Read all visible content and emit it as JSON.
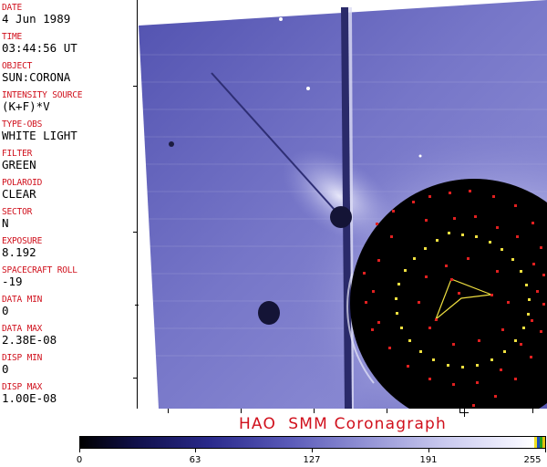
{
  "metadata": [
    {
      "label": "DATE",
      "value": "4 Jun 1989"
    },
    {
      "label": "TIME",
      "value": "03:44:56 UT"
    },
    {
      "label": "OBJECT",
      "value": "SUN:CORONA"
    },
    {
      "label": "INTENSITY SOURCE",
      "value": "(K+F)*V"
    },
    {
      "label": "TYPE-OBS",
      "value": "WHITE LIGHT"
    },
    {
      "label": "FILTER",
      "value": "GREEN"
    },
    {
      "label": "POLAROID",
      "value": "CLEAR"
    },
    {
      "label": "SECTOR",
      "value": "N"
    },
    {
      "label": "EXPOSURE",
      "value": "8.192"
    },
    {
      "label": "SPACECRAFT ROLL",
      "value": "-19"
    },
    {
      "label": "DATA MIN",
      "value": "0"
    },
    {
      "label": "DATA MAX",
      "value": "2.38E-08"
    },
    {
      "label": "DISP MIN",
      "value": "0"
    },
    {
      "label": "DISP MAX",
      "value": "1.00E-08"
    }
  ],
  "image": {
    "title": "HAO  SMM Coronagraph",
    "description_colors": {
      "corona": "#7070c8",
      "occulter": "#000000",
      "markers": "#e02020",
      "ring": "#f0e040"
    }
  },
  "colorbar": {
    "ticks": [
      "0",
      "63",
      "127",
      "191",
      "255"
    ]
  }
}
